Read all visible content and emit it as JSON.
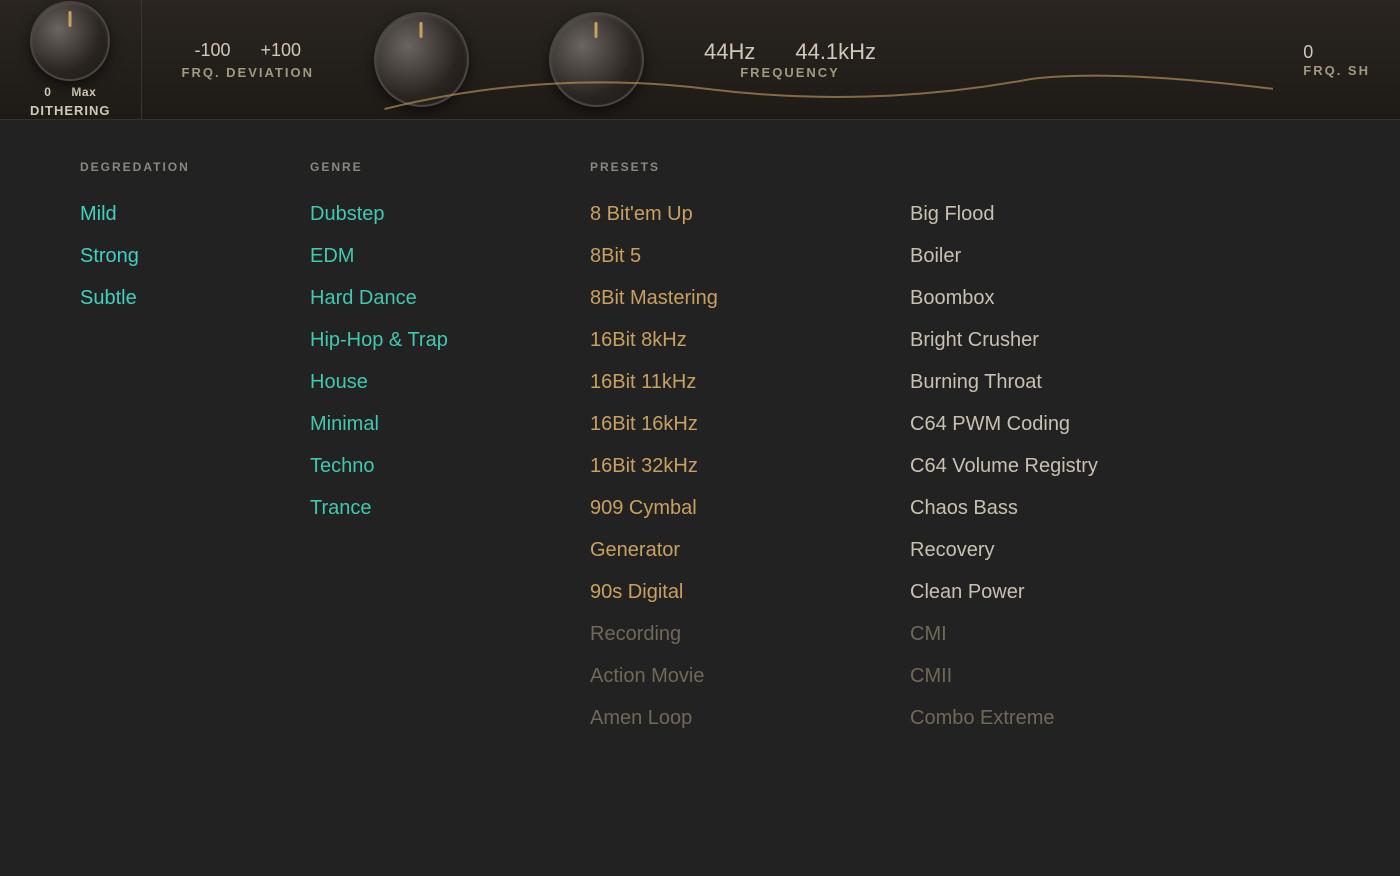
{
  "topPanel": {
    "dithering": {
      "label": "DITHERING",
      "min": "0",
      "max": "Max"
    },
    "frvDeviation": {
      "label": "FRQ. DEVIATION",
      "min": "-100",
      "max": "+100"
    },
    "frequency": {
      "label": "FREQUENCY",
      "value1": "44Hz",
      "value2": "44.1kHz"
    },
    "fruSh": {
      "label": "FRQ. SH",
      "value": "0"
    }
  },
  "sections": {
    "degradation": {
      "header": "DEGREDATION",
      "items": [
        "Mild",
        "Strong",
        "Subtle"
      ]
    },
    "genre": {
      "header": "GENRE",
      "items": [
        "Dubstep",
        "EDM",
        "Hard Dance",
        "Hip-Hop & Trap",
        "House",
        "Minimal",
        "Techno",
        "Trance"
      ]
    },
    "presetsLeft": {
      "header": "PRESETS",
      "activeItems": [
        "8 Bit'em Up",
        "8Bit 5",
        "8Bit Mastering",
        "16Bit 8kHz",
        "16Bit 11kHz",
        "16Bit 16kHz",
        "16Bit 32kHz",
        "909 Cymbal",
        "Generator",
        "90s Digital"
      ],
      "inactiveItems": [
        "Recording",
        "Action Movie",
        "Amen Loop"
      ]
    },
    "presetsRight": {
      "activeItems": [
        "Big Flood",
        "Boiler",
        "Boombox",
        "Bright Crusher",
        "Burning Throat",
        "C64 PWM Coding",
        "C64 Volume Registry",
        "Chaos Bass",
        "Recovery",
        "Clean Power"
      ],
      "inactiveItems": [
        "CMI",
        "CMII",
        "Combo Extreme"
      ]
    }
  }
}
